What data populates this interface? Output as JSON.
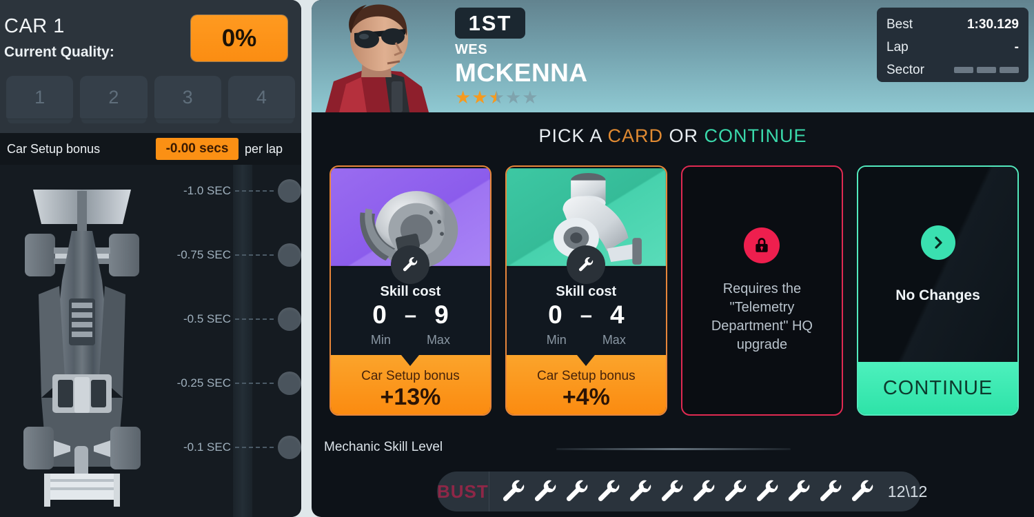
{
  "left_panel": {
    "title": "CAR 1",
    "subtitle": "Current Quality:",
    "quality_value": "0%",
    "quality_color": "#fb8d12",
    "car_tabs": [
      "1",
      "2",
      "3",
      "4"
    ],
    "setup_bonus_label": "Car Setup bonus",
    "setup_bonus_value": "-0.00 secs",
    "setup_bonus_suffix": "per lap",
    "tick_marks": [
      {
        "label": "-1.0 SEC"
      },
      {
        "label": "-0.75 SEC"
      },
      {
        "label": "-0.5 SEC"
      },
      {
        "label": "-0.25 SEC"
      },
      {
        "label": "-0.1 SEC"
      }
    ],
    "car_illustration_icon": "f1-car-top-view-icon"
  },
  "driver": {
    "position": "1ST",
    "first_name": "WES",
    "last_name": "MCKENNA",
    "rating_stars": 2.5,
    "max_stars": 5,
    "star_color": "#f59a20",
    "portrait_icon": "driver-portrait-icon"
  },
  "timing": {
    "rows": [
      {
        "key": "Best",
        "value": "1:30.129"
      },
      {
        "key": "Lap",
        "value": "-"
      },
      {
        "key": "Sector",
        "value": ""
      }
    ],
    "sector_count": 3
  },
  "pick_title": {
    "part1": "PICK A ",
    "part2": "CARD",
    "part3": " OR ",
    "part4": "CONTINUE"
  },
  "cards": [
    {
      "type": "skill",
      "art_icon": "brake-disc-icon",
      "art_color": "#9a6cf0",
      "badge_icon": "wrench-icon",
      "skill_cost_label": "Skill cost",
      "min_value": "0",
      "dash": "–",
      "max_value": "9",
      "min_label": "Min",
      "max_label": "Max",
      "bonus_label": "Car Setup bonus",
      "bonus_value": "+13%",
      "border_color": "#e8863a"
    },
    {
      "type": "skill",
      "art_icon": "turbo-icon",
      "art_color": "#3dc8a3",
      "badge_icon": "wrench-icon",
      "skill_cost_label": "Skill cost",
      "min_value": "0",
      "dash": "–",
      "max_value": "4",
      "min_label": "Min",
      "max_label": "Max",
      "bonus_label": "Car Setup bonus",
      "bonus_value": "+4%",
      "border_color": "#e8863a"
    },
    {
      "type": "locked",
      "lock_icon": "lock-icon",
      "locked_text": "Requires the \"Telemetry Department\" HQ upgrade",
      "border_color": "#e02a52"
    },
    {
      "type": "continue",
      "chevron_icon": "chevron-right-icon",
      "no_changes_label": "No Changes",
      "continue_label": "CONTINUE",
      "border_color": "#53e9bd"
    }
  ],
  "mechanic": {
    "label": "Mechanic Skill Level",
    "bust_label": "BUST",
    "wrench_icon": "wrench-icon",
    "wrench_count": 12,
    "count_text": "12\\12"
  }
}
